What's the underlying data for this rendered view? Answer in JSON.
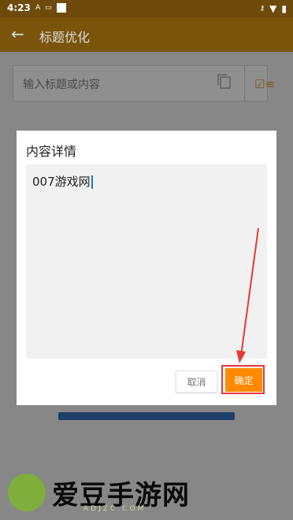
{
  "status_bar": {
    "time": "4:23",
    "icons": [
      "a-icon",
      "cast-icon",
      "square-icon",
      "key-icon",
      "wifi-icon",
      "battery-icon"
    ]
  },
  "app_bar": {
    "title": "标题优化",
    "back_icon": "back-arrow-icon"
  },
  "search": {
    "placeholder": "输入标题或内容",
    "copy_icon": "copy-icon",
    "checklist_icon": "checklist-icon"
  },
  "dialog": {
    "title": "内容详情",
    "content": "007游戏网",
    "cancel_label": "取消",
    "confirm_label": "确定"
  },
  "colors": {
    "accent": "#ff8a00",
    "highlight": "#e53935",
    "appbar_dimmed": "#7a540b"
  },
  "watermark": {
    "title": "爱豆手游网",
    "sub": "ADJZC.COM"
  }
}
